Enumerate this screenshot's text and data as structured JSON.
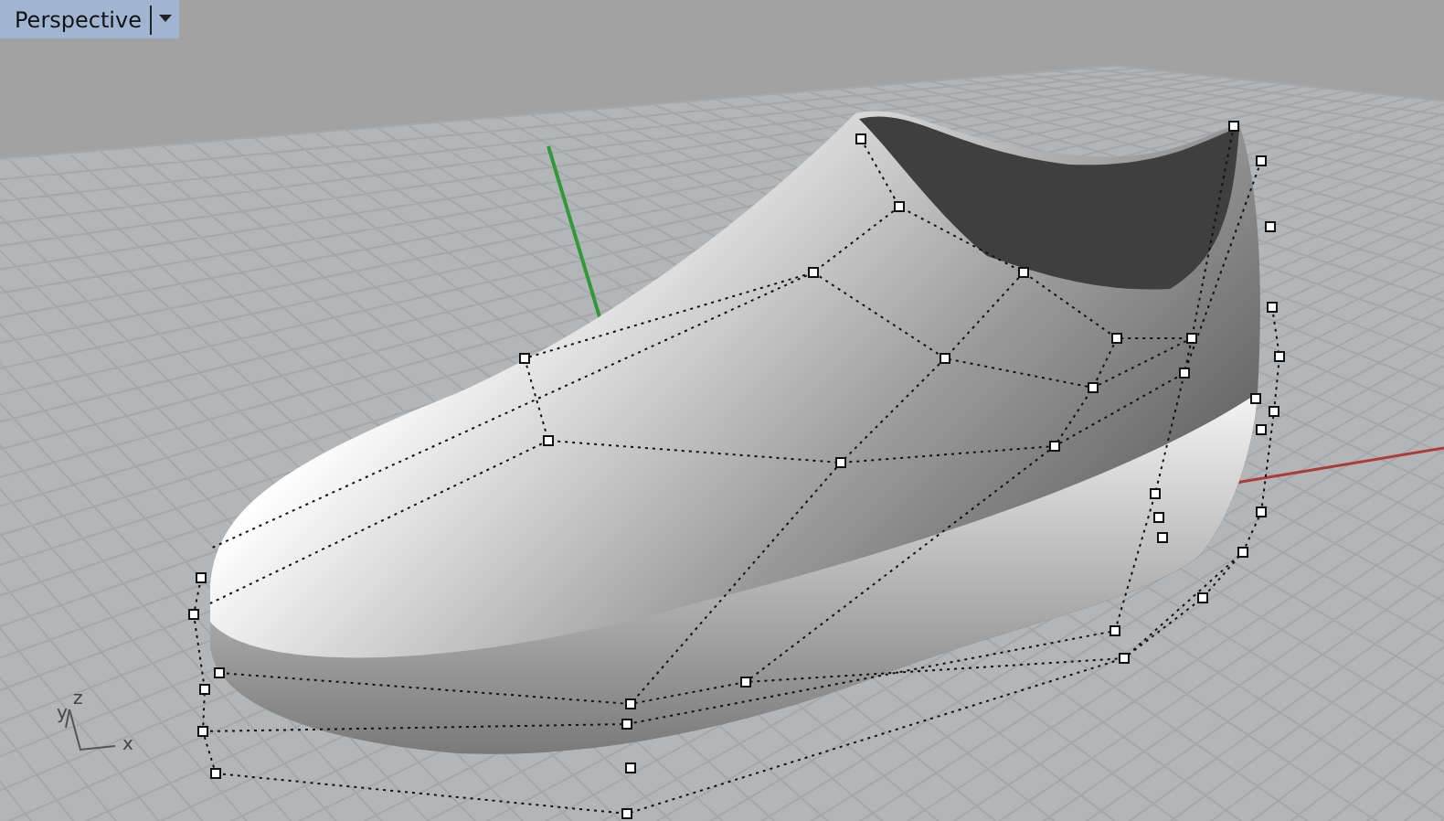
{
  "viewport": {
    "label": "Perspective"
  },
  "axis_labels": [
    "z",
    "y",
    "x"
  ]
}
